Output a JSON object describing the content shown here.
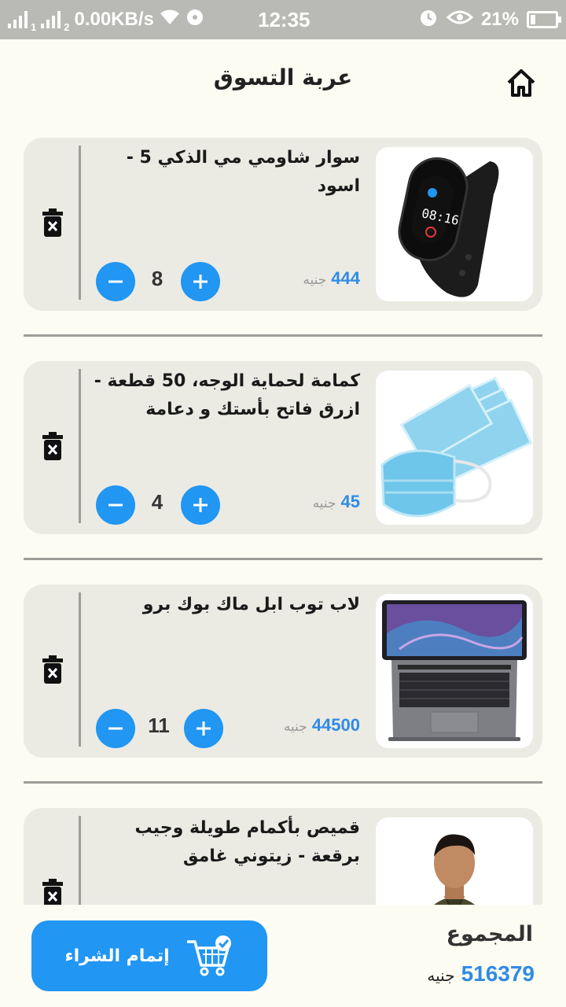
{
  "status_bar": {
    "sim1": "1",
    "sim2": "2",
    "speed": "0.00KB/s",
    "time": "12:35",
    "battery": "21%"
  },
  "header": {
    "title": "عربة التسوق",
    "home_icon": "home-icon"
  },
  "currency": "جنيه",
  "items": [
    {
      "name": "سوار شاومي مي الذكي 5 - اسود",
      "price": "444",
      "quantity": "8",
      "image": "smart-band"
    },
    {
      "name": "كمامة لحماية الوجه، 50 قطعة - ازرق فاتح بأستك و دعامة",
      "price": "45",
      "quantity": "4",
      "image": "face-masks"
    },
    {
      "name": "لاب توب ابل ماك بوك برو",
      "price": "44500",
      "quantity": "11",
      "image": "laptop"
    },
    {
      "name": "قميص بأكمام طويلة وجيب برقعة - زيتوني غامق",
      "price": "",
      "quantity": "",
      "image": "shirt-model"
    }
  ],
  "footer": {
    "total_label": "المجموع",
    "total_value": "516379",
    "checkout_label": "إتمام الشراء",
    "cart_icon": "cart-check-icon"
  },
  "colors": {
    "accent": "#2196f3",
    "price": "#2f8be6",
    "card": "#ebebe4",
    "background": "#fcfcf2"
  }
}
